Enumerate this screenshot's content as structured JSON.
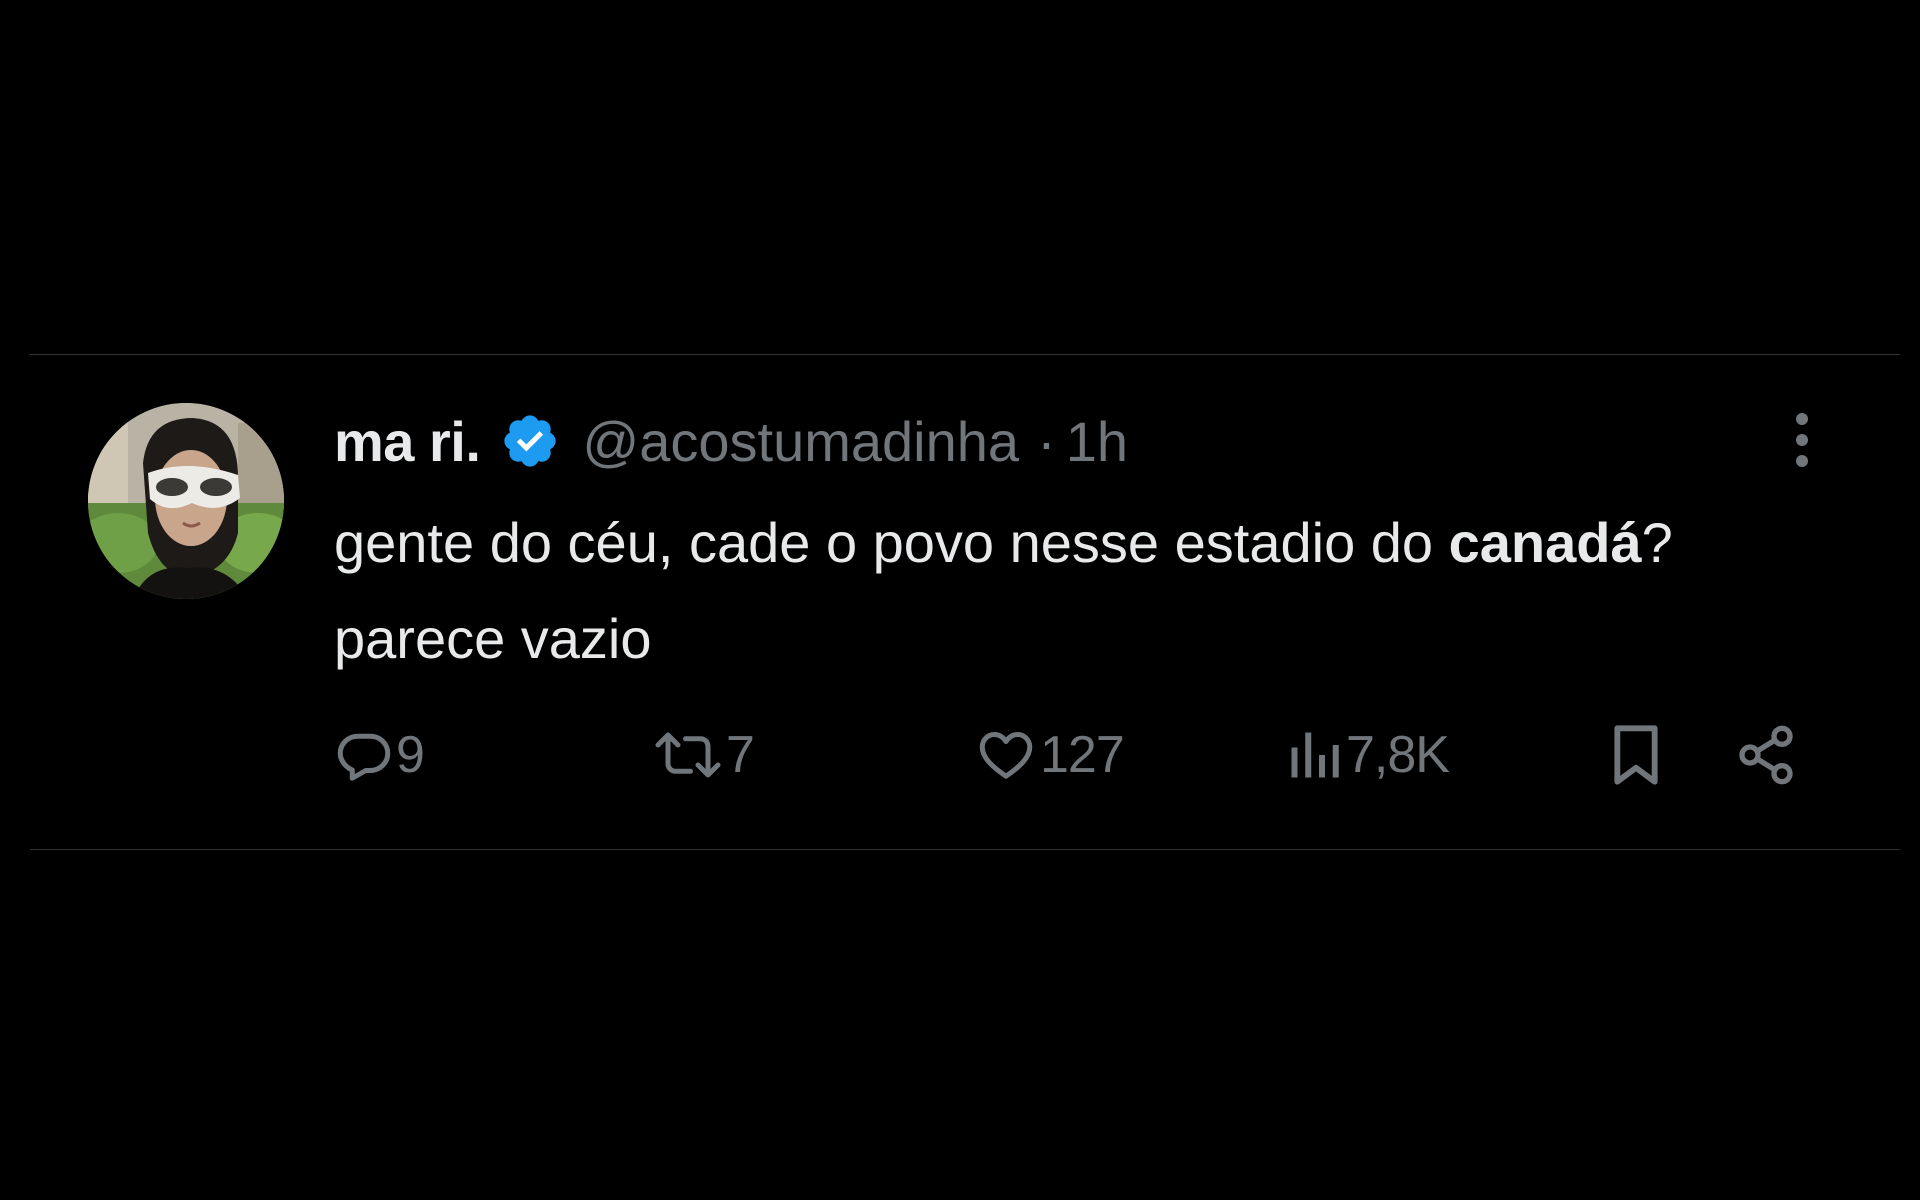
{
  "tweet": {
    "display_name": "ma ri.",
    "handle": "@acostumadinha",
    "separator": "·",
    "time": "1h",
    "text_part1": "gente do céu, cade o povo nesse estadio do ",
    "text_bold": "canadá",
    "text_part2": "? parece vazio",
    "verified_icon": "verified-badge-icon",
    "avatar_icon": "profile-photo"
  },
  "actions": {
    "replies": "9",
    "retweets": "7",
    "likes": "127",
    "views": "7,8K"
  },
  "colors": {
    "background": "#000000",
    "text_primary": "#e7e9ea",
    "text_secondary": "#71767b",
    "verified_blue": "#1d9bf0",
    "divider": "#2f3336"
  }
}
